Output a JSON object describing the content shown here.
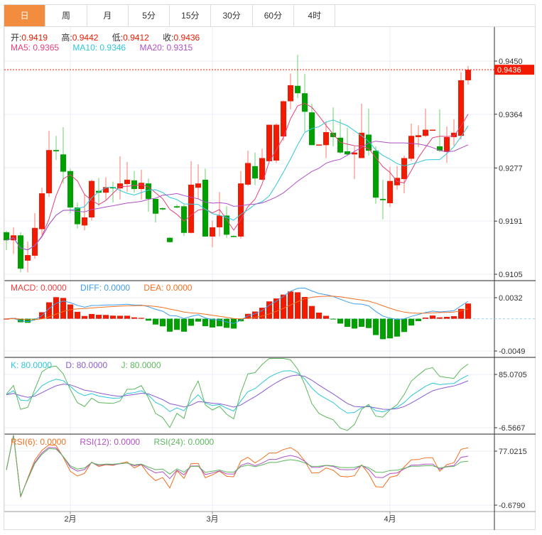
{
  "tabs": [
    {
      "label": "日",
      "active": true
    },
    {
      "label": "周"
    },
    {
      "label": "月"
    },
    {
      "label": "5分"
    },
    {
      "label": "15分"
    },
    {
      "label": "30分"
    },
    {
      "label": "60分"
    },
    {
      "label": "4时"
    }
  ],
  "legend": {
    "open_label": "开:",
    "open": "0.9419",
    "high_label": "高:",
    "high": "0.9442",
    "low_label": "低:",
    "low": "0.9412",
    "close_label": "收:",
    "close": "0.9436",
    "ma5": "MA5: 0.9365",
    "ma10": "MA10: 0.9346",
    "ma20": "MA20: 0.9315",
    "macd": "MACD: 0.0000",
    "diff": "DIFF: 0.0000",
    "dea": "DEA: 0.0000",
    "k": "K: 80.0000",
    "d": "D: 80.0000",
    "j": "J: 80.0000",
    "rsi6": "RSI(6): 0.0000",
    "rsi12": "RSI(12): 0.0000",
    "rsi24": "RSI(24): 0.0000"
  },
  "colors": {
    "up": "#f21a00",
    "down": "#00a000",
    "ma5": "#e8407a",
    "ma10": "#2ec7d9",
    "ma20": "#b04fc7",
    "diff": "#3d9ef0",
    "dea": "#f07020",
    "k": "#2ec7d9",
    "d": "#8a5cd0",
    "j": "#5cb85c",
    "rsi6": "#f07020",
    "rsi12": "#b04fc7",
    "rsi24": "#5cb85c",
    "active_tab": "#f28c3f"
  },
  "chart_data": {
    "type": "candlestick",
    "price_axis": {
      "ticks": [
        "0.9450",
        "0.9364",
        "0.9277",
        "0.9191",
        "0.9105"
      ],
      "range": [
        0.9105,
        0.945
      ]
    },
    "last_price": "0.9436",
    "macd_axis": {
      "ticks": [
        "0.0032",
        "-0.0049"
      ],
      "range": [
        -0.0049,
        0.0032
      ]
    },
    "kdj_axis": {
      "ticks": [
        "85.0705",
        "-6.5667"
      ],
      "range": [
        -6.5667,
        85.0705
      ]
    },
    "rsi_axis": {
      "ticks": [
        "77.0215",
        "-0.6790"
      ],
      "range": [
        -0.679,
        77.0215
      ]
    },
    "x_labels": [
      {
        "label": "2月",
        "index": 9
      },
      {
        "label": "3月",
        "index": 29
      },
      {
        "label": "4月",
        "index": 54
      }
    ],
    "ohlc": [
      [
        0.9173,
        0.9175,
        0.9144,
        0.916
      ],
      [
        0.916,
        0.9181,
        0.9138,
        0.9168
      ],
      [
        0.9168,
        0.9173,
        0.9108,
        0.9114
      ],
      [
        0.9127,
        0.9158,
        0.9108,
        0.9136
      ],
      [
        0.9135,
        0.9204,
        0.913,
        0.918
      ],
      [
        0.9178,
        0.9245,
        0.9169,
        0.9236
      ],
      [
        0.9236,
        0.9337,
        0.923,
        0.9306
      ],
      [
        0.9306,
        0.9329,
        0.929,
        0.9304
      ],
      [
        0.9299,
        0.9343,
        0.9252,
        0.9271
      ],
      [
        0.9272,
        0.9276,
        0.9204,
        0.9213
      ],
      [
        0.9213,
        0.9221,
        0.9179,
        0.9186
      ],
      [
        0.9184,
        0.9235,
        0.9176,
        0.9197
      ],
      [
        0.9197,
        0.9258,
        0.9192,
        0.9256
      ],
      [
        0.924,
        0.9261,
        0.9215,
        0.9237
      ],
      [
        0.9237,
        0.9262,
        0.9225,
        0.9246
      ],
      [
        0.9246,
        0.9255,
        0.9221,
        0.9244
      ],
      [
        0.9244,
        0.9296,
        0.9226,
        0.9252
      ],
      [
        0.9251,
        0.9287,
        0.9238,
        0.9258
      ],
      [
        0.9257,
        0.9272,
        0.9237,
        0.9243
      ],
      [
        0.9243,
        0.9274,
        0.9226,
        0.9253
      ],
      [
        0.9252,
        0.926,
        0.9206,
        0.9227
      ],
      [
        0.9227,
        0.9227,
        0.9189,
        0.9203
      ],
      [
        0.9212,
        0.9213,
        0.9208,
        0.921
      ],
      [
        0.9164,
        0.9165,
        0.9156,
        0.9157
      ],
      [
        0.9215,
        0.9218,
        0.9212,
        0.9213
      ],
      [
        0.9215,
        0.9218,
        0.9167,
        0.9172
      ],
      [
        0.9172,
        0.9288,
        0.9171,
        0.925
      ],
      [
        0.9245,
        0.9283,
        0.9227,
        0.9252
      ],
      [
        0.9258,
        0.9276,
        0.9166,
        0.9166
      ],
      [
        0.9166,
        0.9192,
        0.9149,
        0.9181
      ],
      [
        0.9181,
        0.9238,
        0.9166,
        0.92
      ],
      [
        0.92,
        0.9215,
        0.9164,
        0.9169
      ],
      [
        0.9167,
        0.9168,
        0.9165,
        0.9166
      ],
      [
        0.9166,
        0.9272,
        0.9163,
        0.9252
      ],
      [
        0.925,
        0.9305,
        0.9248,
        0.9285
      ],
      [
        0.928,
        0.9302,
        0.9249,
        0.926
      ],
      [
        0.9258,
        0.9308,
        0.9257,
        0.9293
      ],
      [
        0.9288,
        0.9347,
        0.9287,
        0.9347
      ],
      [
        0.9289,
        0.9349,
        0.9285,
        0.9347
      ],
      [
        0.9328,
        0.9386,
        0.9321,
        0.9385
      ],
      [
        0.9385,
        0.943,
        0.9372,
        0.9411
      ],
      [
        0.941,
        0.946,
        0.939,
        0.9398
      ],
      [
        0.9398,
        0.9429,
        0.9336,
        0.9368
      ],
      [
        0.9367,
        0.9381,
        0.9314,
        0.9314
      ],
      [
        0.9315,
        0.9315,
        0.9315,
        0.9315
      ],
      [
        0.9314,
        0.9352,
        0.9293,
        0.9335
      ],
      [
        0.9334,
        0.9375,
        0.9312,
        0.9327
      ],
      [
        0.9326,
        0.9356,
        0.93,
        0.9302
      ],
      [
        0.9304,
        0.9342,
        0.9297,
        0.9299
      ],
      [
        0.9299,
        0.9312,
        0.9259,
        0.9302
      ],
      [
        0.9293,
        0.9381,
        0.9293,
        0.9334
      ],
      [
        0.9331,
        0.9373,
        0.9297,
        0.9305
      ],
      [
        0.9305,
        0.9312,
        0.9219,
        0.9229
      ],
      [
        0.9227,
        0.9258,
        0.9194,
        0.9225
      ],
      [
        0.922,
        0.9279,
        0.9214,
        0.9256
      ],
      [
        0.9249,
        0.928,
        0.9242,
        0.9261
      ],
      [
        0.9259,
        0.9297,
        0.9236,
        0.9293
      ],
      [
        0.9292,
        0.9349,
        0.9288,
        0.9329
      ],
      [
        0.9327,
        0.9346,
        0.9311,
        0.933
      ],
      [
        0.9329,
        0.9373,
        0.9327,
        0.9339
      ],
      [
        0.9339,
        0.9339,
        0.9339,
        0.9339
      ],
      [
        0.9312,
        0.9372,
        0.9303,
        0.9305
      ],
      [
        0.9303,
        0.9344,
        0.9285,
        0.9327
      ],
      [
        0.9327,
        0.9356,
        0.9313,
        0.9334
      ],
      [
        0.9329,
        0.9432,
        0.9323,
        0.9419
      ],
      [
        0.9419,
        0.9442,
        0.9412,
        0.9436
      ]
    ]
  }
}
